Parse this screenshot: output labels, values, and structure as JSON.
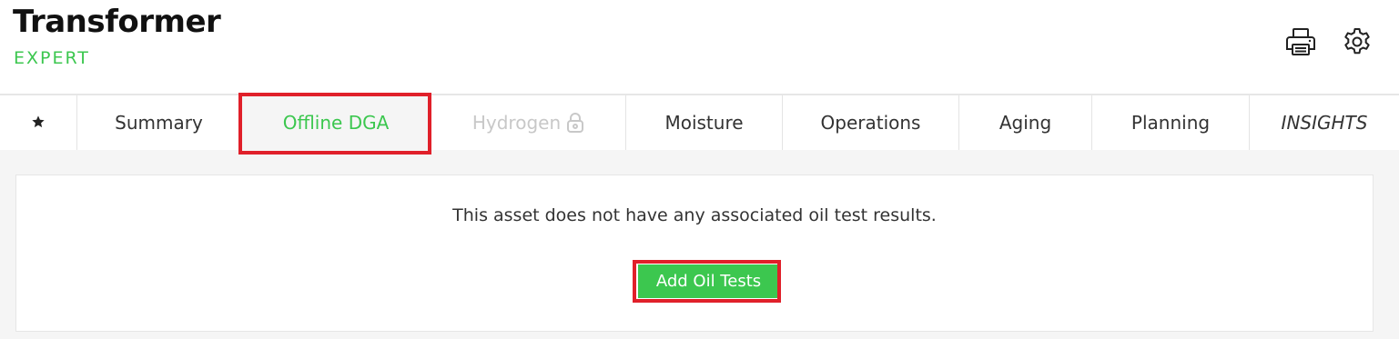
{
  "header": {
    "title": "Transformer",
    "subtitle": "EXPERT",
    "icons": [
      "print-icon",
      "gear-icon"
    ]
  },
  "tabs": [
    {
      "label": "",
      "icon": "star-icon"
    },
    {
      "label": "Summary"
    },
    {
      "label": "Offline DGA",
      "active": true
    },
    {
      "label": "Hydrogen",
      "disabled": true,
      "icon": "lock-icon"
    },
    {
      "label": "Moisture"
    },
    {
      "label": "Operations"
    },
    {
      "label": "Aging"
    },
    {
      "label": "Planning"
    },
    {
      "label": "INSIGHTS"
    }
  ],
  "main": {
    "message": "This asset does not have any associated oil test results.",
    "button_label": "Add Oil Tests"
  },
  "colors": {
    "accent": "#3cc74f",
    "highlight": "#e0202a",
    "disabled": "#c8c8c8",
    "background": "#f5f5f5"
  }
}
